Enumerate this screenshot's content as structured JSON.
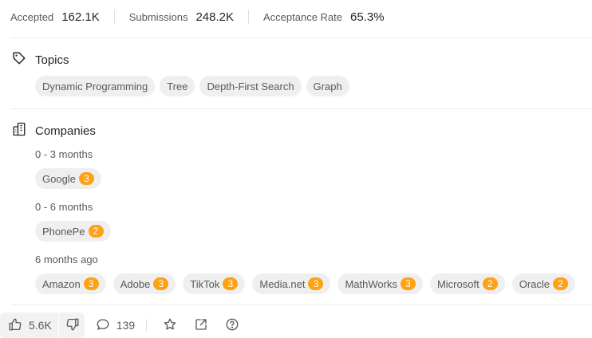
{
  "stats": [
    {
      "label": "Accepted",
      "value": "162.1K"
    },
    {
      "label": "Submissions",
      "value": "248.2K"
    },
    {
      "label": "Acceptance Rate",
      "value": "65.3%"
    }
  ],
  "topics": {
    "title": "Topics",
    "tags": [
      "Dynamic Programming",
      "Tree",
      "Depth-First Search",
      "Graph"
    ]
  },
  "companies": {
    "title": "Companies",
    "groups": [
      {
        "period": "0 - 3 months",
        "items": [
          {
            "name": "Google",
            "count": "3"
          }
        ]
      },
      {
        "period": "0 - 6 months",
        "items": [
          {
            "name": "PhonePe",
            "count": "2"
          }
        ]
      },
      {
        "period": "6 months ago",
        "items": [
          {
            "name": "Amazon",
            "count": "3"
          },
          {
            "name": "Adobe",
            "count": "3"
          },
          {
            "name": "TikTok",
            "count": "3"
          },
          {
            "name": "Media.net",
            "count": "3"
          },
          {
            "name": "MathWorks",
            "count": "3"
          },
          {
            "name": "Microsoft",
            "count": "2"
          },
          {
            "name": "Oracle",
            "count": "2"
          }
        ]
      }
    ]
  },
  "footer": {
    "likes": "5.6K",
    "comments": "139",
    "icons": [
      "thumbs-up-icon",
      "thumbs-down-icon",
      "comment-icon",
      "star-icon",
      "share-icon",
      "help-icon"
    ]
  },
  "colors": {
    "accent": "#ffa116",
    "tag_bg": "#efefef"
  }
}
